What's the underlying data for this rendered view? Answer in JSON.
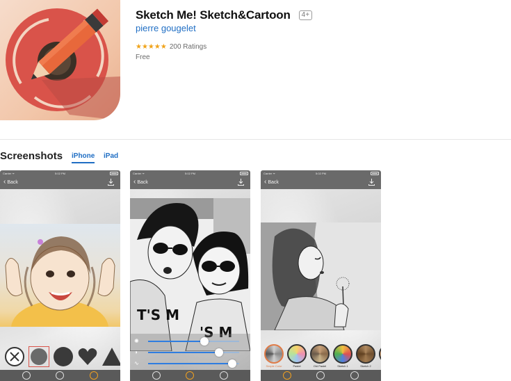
{
  "app": {
    "title": "Sketch Me! Sketch&Cartoon",
    "age_rating": "4+",
    "developer": "pierre gougelet",
    "stars": "★★★★★",
    "rating_value": 4.5,
    "ratings_count": "200 Ratings",
    "price": "Free",
    "icon": "pencil-over-red-circle-icon"
  },
  "screenshots_section": {
    "title": "Screenshots",
    "tabs": [
      {
        "label": "iPhone",
        "selected": true
      },
      {
        "label": "iPad",
        "selected": false
      }
    ]
  },
  "phones": [
    {
      "status": {
        "carrier": "Carrier ᯤ",
        "time": "5:02 PM"
      },
      "nav": {
        "back_label": "Back",
        "download_icon": "download-icon"
      },
      "photo_desc_icon": "sketch-photo-child-icon",
      "shapes": [
        "circle-x-icon",
        "soft-circle-icon",
        "circle-icon",
        "heart-icon",
        "triangle-icon",
        "circle-icon"
      ],
      "tab_icons": [
        "effects-icon",
        "adjust-icon",
        "frame-icon"
      ],
      "active_tab": 2
    },
    {
      "status": {
        "carrier": "Carrier ᯤ",
        "time": "5:02 PM"
      },
      "nav": {
        "back_label": "Back",
        "download_icon": "download-icon"
      },
      "photo_desc_icon": "sketch-photo-couple-icon",
      "sliders": [
        {
          "icon": "brightness-icon",
          "level": 0.62
        },
        {
          "icon": "contrast-icon",
          "level": 0.78
        },
        {
          "icon": "curve-icon",
          "level": 0.92
        }
      ],
      "tab_icons": [
        "effects-icon",
        "adjust-icon",
        "frame-icon"
      ],
      "active_tab": 1
    },
    {
      "status": {
        "carrier": "Carrier ᯤ",
        "time": "5:02 PM"
      },
      "nav": {
        "back_label": "Back",
        "download_icon": "download-icon"
      },
      "photo_desc_icon": "sketch-photo-woman-dandelion-icon",
      "filters": [
        {
          "label": "Simple Color",
          "selected": true
        },
        {
          "label": "Pastel",
          "selected": false
        },
        {
          "label": "Old Pastel",
          "selected": false
        },
        {
          "label": "Sketch 1",
          "selected": false
        },
        {
          "label": "Sketch 2",
          "selected": false
        },
        {
          "label": "",
          "selected": false
        }
      ],
      "tab_icons": [
        "effects-icon",
        "adjust-icon",
        "frame-icon"
      ],
      "active_tab": 0
    }
  ],
  "colors": {
    "link_blue": "#1f6ec4",
    "star_orange": "#f0a31a",
    "nav_gray": "#6a6a6a",
    "accent_orange": "#f0a020"
  }
}
